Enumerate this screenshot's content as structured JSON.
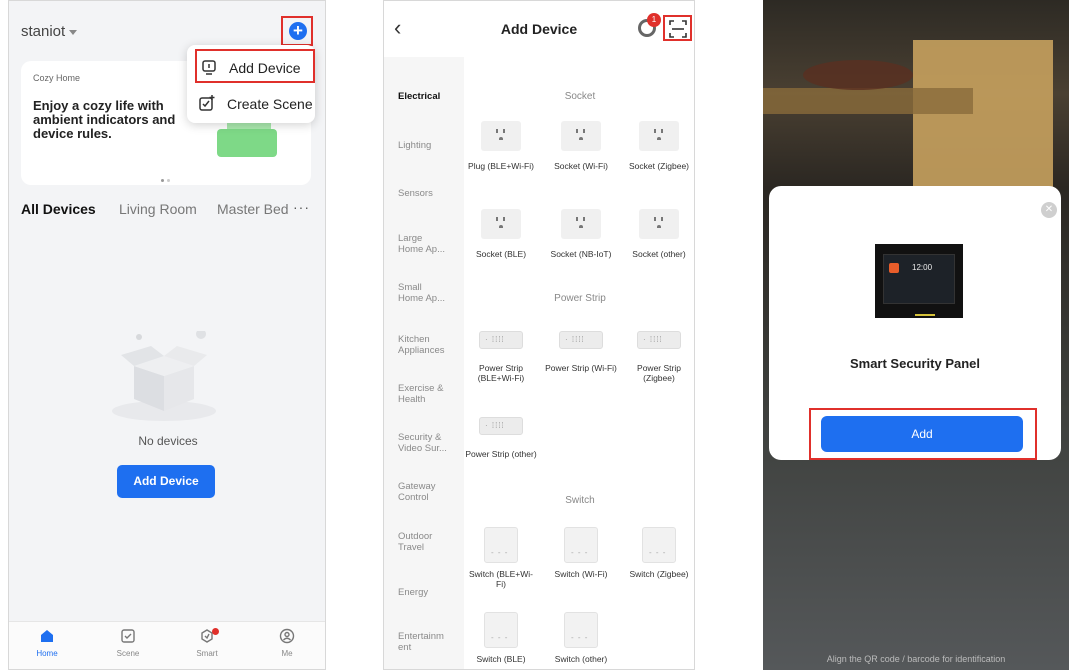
{
  "screen1": {
    "home_name": "staniot",
    "menu": {
      "add_device": "Add Device",
      "create_scene": "Create Scene"
    },
    "banner": {
      "tag": "Cozy Home",
      "text": "Enjoy a cozy life with ambient indicators and device rules."
    },
    "tabs": [
      "All Devices",
      "Living Room",
      "Master Bed",
      "···"
    ],
    "empty_text": "No devices",
    "add_device_button": "Add Device",
    "nav": [
      "Home",
      "Scene",
      "Smart",
      "Me"
    ]
  },
  "screen2": {
    "title": "Add Device",
    "notification_count": "1",
    "categories": [
      "Electrical",
      "Lighting",
      "Sensors",
      "Large Home Ap...",
      "Small Home Ap...",
      "Kitchen Appliances",
      "Exercise & Health",
      "Security & Video Sur...",
      "Gateway Control",
      "Outdoor Travel",
      "Energy",
      "Entertainm ent"
    ],
    "sections": {
      "socket": "Socket",
      "power_strip": "Power Strip",
      "switch": "Switch"
    },
    "devices": {
      "socket": [
        "Plug (BLE+Wi-Fi)",
        "Socket (Wi-Fi)",
        "Socket (Zigbee)",
        "Socket (BLE)",
        "Socket (NB-IoT)",
        "Socket (other)"
      ],
      "power_strip": [
        "Power Strip (BLE+Wi-Fi)",
        "Power Strip (Wi-Fi)",
        "Power Strip (Zigbee)",
        "Power Strip (other)"
      ],
      "switch": [
        "Switch (BLE+Wi-Fi)",
        "Switch (Wi-Fi)",
        "Switch (Zigbee)",
        "Switch (BLE)",
        "Switch (other)"
      ]
    }
  },
  "screen3": {
    "panel_clock": "12:00",
    "modal_title": "Smart Security Panel",
    "add_button": "Add",
    "hint": "Align the QR code / barcode for identification"
  },
  "colors": {
    "accent": "#1e6ff0",
    "highlight": "#e0302b"
  }
}
